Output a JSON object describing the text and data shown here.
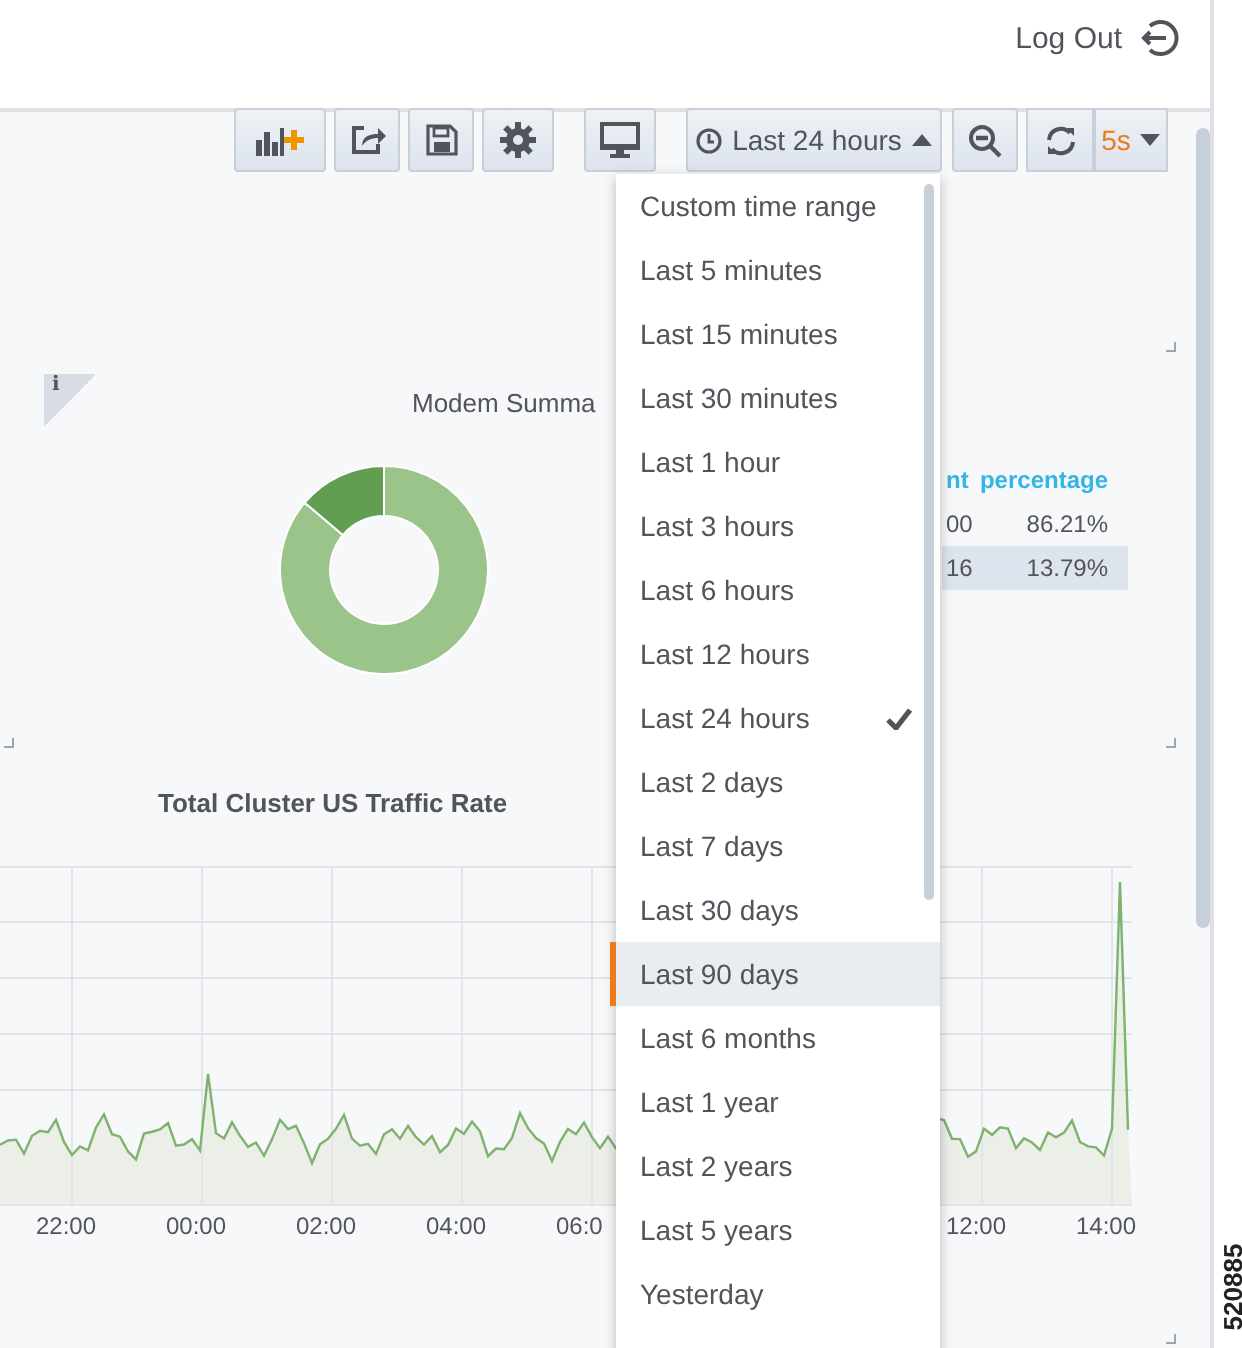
{
  "header": {
    "logout": "Log Out"
  },
  "toolbar": {
    "time_range": "Last 24 hours",
    "refresh_interval": "5s"
  },
  "modem_panel": {
    "title": "Modem Summa",
    "info_mark": "i",
    "chart_data": {
      "type": "donut",
      "values": [
        86.21,
        13.79
      ]
    },
    "table": {
      "columns": [
        "nt",
        "percentage"
      ],
      "rows": [
        {
          "cells": [
            "00",
            "86.21%"
          ],
          "highlighted": false
        },
        {
          "cells": [
            "16",
            "13.79%"
          ],
          "highlighted": true
        }
      ]
    }
  },
  "traffic_panel": {
    "title": "Total Cluster US Traffic Rate",
    "xticks": [
      "22:00",
      "00:00",
      "02:00",
      "04:00",
      "06:0",
      "12:00",
      "14:00"
    ]
  },
  "time_menu": {
    "items": [
      {
        "label": "Custom time range",
        "selected": false,
        "hovered": false
      },
      {
        "label": "Last 5 minutes",
        "selected": false,
        "hovered": false
      },
      {
        "label": "Last 15 minutes",
        "selected": false,
        "hovered": false
      },
      {
        "label": "Last 30 minutes",
        "selected": false,
        "hovered": false
      },
      {
        "label": "Last 1 hour",
        "selected": false,
        "hovered": false
      },
      {
        "label": "Last 3 hours",
        "selected": false,
        "hovered": false
      },
      {
        "label": "Last 6 hours",
        "selected": false,
        "hovered": false
      },
      {
        "label": "Last 12 hours",
        "selected": false,
        "hovered": false
      },
      {
        "label": "Last 24 hours",
        "selected": true,
        "hovered": false
      },
      {
        "label": "Last 2 days",
        "selected": false,
        "hovered": false
      },
      {
        "label": "Last 7 days",
        "selected": false,
        "hovered": false
      },
      {
        "label": "Last 30 days",
        "selected": false,
        "hovered": false
      },
      {
        "label": "Last 90 days",
        "selected": false,
        "hovered": true
      },
      {
        "label": "Last 6 months",
        "selected": false,
        "hovered": false
      },
      {
        "label": "Last 1 year",
        "selected": false,
        "hovered": false
      },
      {
        "label": "Last 2 years",
        "selected": false,
        "hovered": false
      },
      {
        "label": "Last 5 years",
        "selected": false,
        "hovered": false
      },
      {
        "label": "Yesterday",
        "selected": false,
        "hovered": false
      }
    ]
  },
  "figure_number": "520885"
}
